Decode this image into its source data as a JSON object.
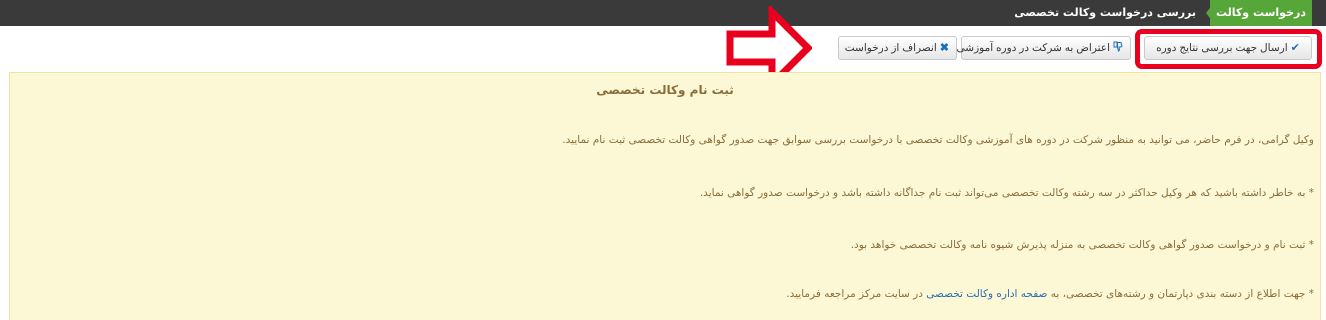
{
  "breadcrumb": {
    "root": "درخواست وکالت تخصصی",
    "current": "بررسی درخواست وکالت تخصصی"
  },
  "toolbar": {
    "send_label": "ارسال جهت بررسی نتایج دوره",
    "objection_label": "اعتراض به شرکت در دوره آموزشی",
    "cancel_label": "انصراف از درخواست"
  },
  "panel": {
    "title": "ثبت نام وکالت تخصصی",
    "intro": "وکیل گرامی، در فرم حاضر، می توانید به منظور شرکت در دوره های آموزشی وکالت تخصصی با درخواست بررسی سوابق جهت صدور گواهی وکالت تخصصی ثبت نام نمایید.",
    "note1": "* به خاطر داشته باشید که هر وکیل حداکثر در سه رشته وکالت تخصصی می‌تواند ثبت نام جداگانه داشته باشد و درخواست صدور گواهی نماید.",
    "note2": "* ثبت نام و درخواست صدور گواهی وکالت تخصصی به منزله پذیرش شیوه نامه وکالت تخصصی خواهد بود.",
    "note3_before": "* جهت اطلاع از دسته بندی دپارتمان و رشته‌های تخصصی، به",
    "note3_link": "صفحه اداره وکالت تخصصی",
    "note3_after": "در سایت مرکز مراجعه فرمایید."
  },
  "colors": {
    "header_bg": "#3a3a3a",
    "breadcrumb_green": "#57a639",
    "panel_bg": "#fcf8d5",
    "panel_text": "#8a6d3b",
    "highlight_red": "#e8001e",
    "link_blue": "#2a6cb0"
  },
  "icons": {
    "send": "check-icon",
    "objection": "thumbs-down-icon",
    "cancel": "times-icon"
  }
}
